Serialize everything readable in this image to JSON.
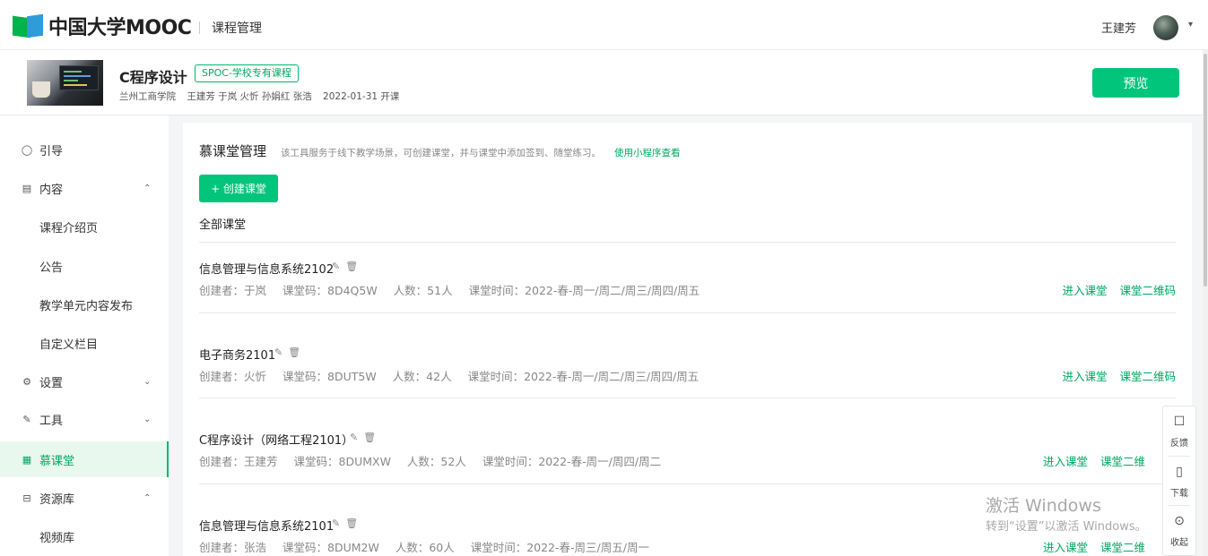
{
  "header": {
    "logo_text": "中国大学MOOC",
    "section_title": "课程管理",
    "user_name": "王建芳",
    "user_caret": "▾"
  },
  "course": {
    "name": "C程序设计",
    "badge": "SPOC-学校专有课程",
    "school": "兰州工商学院",
    "teachers": "王建芳 于岚 火忻 孙娟红 张浩",
    "start": "2022-01-31 开课",
    "preview_label": "预览"
  },
  "sidebar": {
    "items": [
      {
        "icon": "◯",
        "label": "引导",
        "chevron": ""
      },
      {
        "icon": "▤",
        "label": "内容",
        "chevron": "⌃"
      },
      {
        "icon": "",
        "label": "课程介绍页",
        "chevron": ""
      },
      {
        "icon": "",
        "label": "公告",
        "chevron": ""
      },
      {
        "icon": "",
        "label": "教学单元内容发布",
        "chevron": ""
      },
      {
        "icon": "",
        "label": "自定义栏目",
        "chevron": ""
      },
      {
        "icon": "⚙",
        "label": "设置",
        "chevron": "⌄"
      },
      {
        "icon": "✎",
        "label": "工具",
        "chevron": "⌄"
      },
      {
        "icon": "▦",
        "label": "慕课堂",
        "chevron": ""
      },
      {
        "icon": "⊟",
        "label": "资源库",
        "chevron": "⌃"
      },
      {
        "icon": "",
        "label": "视频库",
        "chevron": ""
      }
    ]
  },
  "main": {
    "title": "慕课堂管理",
    "description": "该工具服务于线下教学场景，可创建课堂，并与课堂中添加签到、随堂练习。",
    "link": "使用小程序查看",
    "create_label": "+ 创建课堂",
    "all_label": "全部课堂",
    "rooms": [
      {
        "name": "信息管理与信息系统2102",
        "creator": "创建者：于岚",
        "code": "课堂码：8D4Q5W",
        "count": "人数：51人",
        "time": "课堂时间：2022-春-周一/周二/周三/周四/周五",
        "enter": "进入课堂",
        "qrcode": "课堂二维码"
      },
      {
        "name": "电子商务2101",
        "creator": "创建者：火忻",
        "code": "课堂码：8DUT5W",
        "count": "人数：42人",
        "time": "课堂时间：2022-春-周一/周二/周三/周四/周五",
        "enter": "进入课堂",
        "qrcode": "课堂二维码"
      },
      {
        "name": "C程序设计（网络工程2101）",
        "creator": "创建者：王建芳",
        "code": "课堂码：8DUMXW",
        "count": "人数：52人",
        "time": "课堂时间：2022-春-周一/周四/周二",
        "enter": "进入课堂",
        "qrcode": "课堂二维"
      },
      {
        "name": "信息管理与信息系统2101",
        "creator": "创建者：张浩",
        "code": "课堂码：8DUM2W",
        "count": "人数：60人",
        "time": "课堂时间：2022-春-周三/周五/周一",
        "enter": "进入课堂",
        "qrcode": "课堂二维"
      }
    ]
  },
  "float_tools": {
    "feedback": "反馈",
    "download": "下载",
    "collapse": "收起"
  },
  "watermark": {
    "line1": "激活 Windows",
    "line2": "转到“设置”以激活 Windows。"
  },
  "colors": {
    "accent": "#00c57a",
    "link": "#00a862"
  }
}
